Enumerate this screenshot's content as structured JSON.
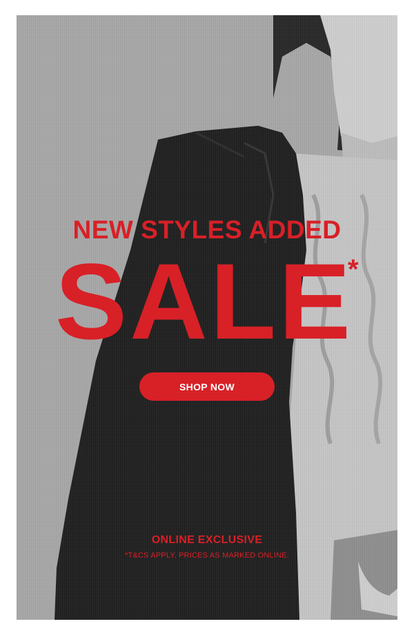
{
  "promo": {
    "headline": "NEW STYLES ADDED",
    "sale_word": "SALE",
    "asterisk": "*",
    "cta_label": "SHOP NOW",
    "channel_note": "ONLINE EXCLUSIVE",
    "terms": "*T&CS APPLY. PRICES AS MARKED ONLINE."
  },
  "colors": {
    "accent": "#d82027",
    "button_text": "#ffffff",
    "background": "#a6a6a6"
  }
}
